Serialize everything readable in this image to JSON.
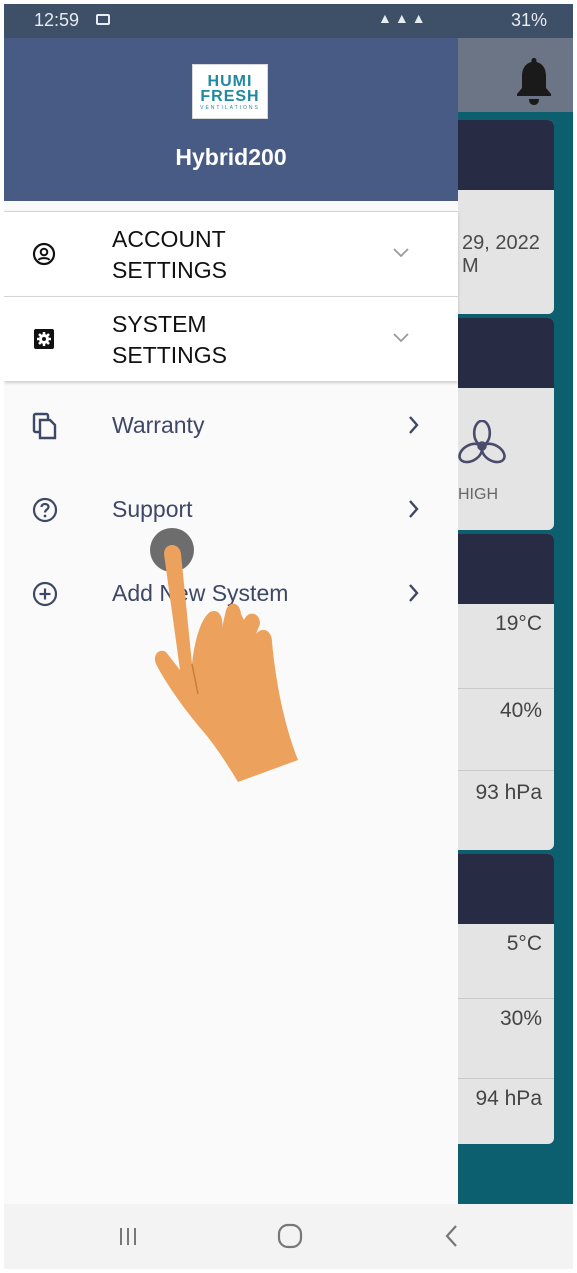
{
  "status_bar": {
    "time": "12:59",
    "battery": "31%"
  },
  "background": {
    "date_fragment": "29, 2022",
    "time_fragment": "M",
    "fan_speed": "HIGH",
    "indoor": {
      "temperature": "19°C",
      "humidity": "40%",
      "pressure": "93 hPa"
    },
    "outdoor": {
      "temperature": "5°C",
      "humidity": "30%",
      "pressure": "94 hPa"
    }
  },
  "drawer": {
    "logo_line1": "HUMI",
    "logo_line2": "FRESH",
    "logo_line3": "VENTILATIONS",
    "device_name": "Hybrid200",
    "sections": [
      {
        "line1": "ACCOUNT",
        "line2": "SETTINGS",
        "icon": "account-circle-icon"
      },
      {
        "line1": "SYSTEM",
        "line2": "SETTINGS",
        "icon": "gear-icon"
      }
    ],
    "items": [
      {
        "label": "Warranty",
        "icon": "copy-icon"
      },
      {
        "label": "Support",
        "icon": "help-circle-icon"
      },
      {
        "label": "Add New System",
        "icon": "add-circle-icon"
      }
    ]
  },
  "colors": {
    "drawer_header": "#485b85",
    "accent_text": "#3e4766",
    "app_background": "#0b5f6e",
    "card_header": "#272c44"
  }
}
